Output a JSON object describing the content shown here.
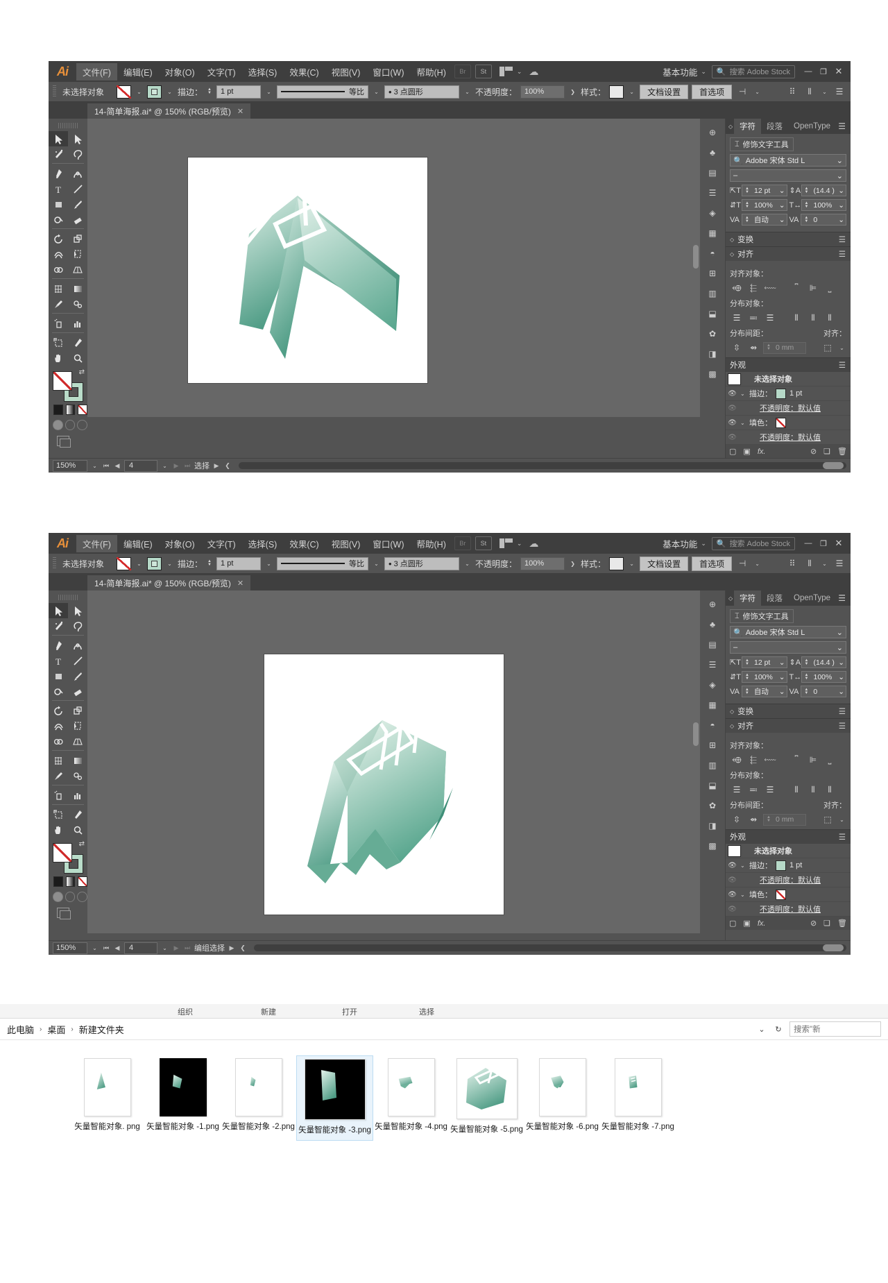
{
  "app": {
    "logo": "Ai",
    "menu": [
      "文件(F)",
      "编辑(E)",
      "对象(O)",
      "文字(T)",
      "选择(S)",
      "效果(C)",
      "视图(V)",
      "窗口(W)",
      "帮助(H)"
    ],
    "bridge_icon": "Br",
    "stock_icon": "St",
    "workspace": "基本功能",
    "search_placeholder": "搜索 Adobe Stock",
    "win_min": "—",
    "win_max": "❐",
    "win_close": "✕"
  },
  "control_bar": {
    "selection_label": "未选择对象",
    "fill_swatch": "none-swatch",
    "stroke_swatch": "mint-swatch",
    "stroke_label": "描边：",
    "stroke_weight": "1 pt",
    "stroke_profile": "等比",
    "brush": "3 点圆形",
    "opacity_label": "不透明度：",
    "opacity_value": "100%",
    "style_label": "样式：",
    "doc_setup": "文档设置",
    "preferences": "首选项",
    "align_icon": "align-icon"
  },
  "document": {
    "tab_title": "14-简单海报.ai* @ 150% (RGB/预览)",
    "tab_close": "✕"
  },
  "toolbar": {
    "tools": [
      "selection-tool",
      "direct-selection-tool",
      "magic-wand-tool",
      "lasso-tool",
      "pen-tool",
      "curvature-tool",
      "type-tool",
      "line-segment-tool",
      "rectangle-tool",
      "paintbrush-tool",
      "shaper-tool",
      "eraser-tool",
      "rotate-tool",
      "scale-tool",
      "width-tool",
      "free-transform-tool",
      "shape-builder-tool",
      "perspective-grid-tool",
      "mesh-tool",
      "gradient-tool",
      "eyedropper-tool",
      "blend-tool",
      "symbol-sprayer-tool",
      "column-graph-tool",
      "artboard-tool",
      "slice-tool",
      "hand-tool",
      "zoom-tool"
    ],
    "fill_color": "#ffffff",
    "stroke_color": "#b9dcc9"
  },
  "panels": {
    "character": {
      "tabs": [
        "字符",
        "段落",
        "OpenType"
      ],
      "active_tab": "字符",
      "touch_type_tool": "修饰文字工具",
      "font_family": "Adobe 宋体 Std L",
      "font_style": "–",
      "font_size": "12 pt",
      "leading": "(14.4 )",
      "horizontal_scale": "100%",
      "vertical_scale": "100%",
      "kerning": "自动",
      "tracking": "0"
    },
    "transform": {
      "title": "变换"
    },
    "align": {
      "title": "对齐",
      "align_objects_label": "对齐对象：",
      "distribute_objects_label": "分布对象：",
      "distribute_spacing_label": "分布间距：",
      "align_to_label": "对齐：",
      "spacing_value": "0 mm"
    },
    "appearance": {
      "title": "外观",
      "no_selection": "未选择对象",
      "stroke_label": "描边：",
      "stroke_weight": "1 pt",
      "stroke_opacity": "不透明度：默认值",
      "fill_label": "填色：",
      "fill_opacity": "不透明度：默认值",
      "footer_icons": [
        "new-stroke-icon",
        "new-fill-icon",
        "fx-icon",
        "clear-appearance-icon",
        "duplicate-item-icon",
        "delete-item-icon"
      ]
    }
  },
  "status_bar_top": {
    "zoom": "150%",
    "page": "4",
    "status": "选择"
  },
  "status_bar_bottom": {
    "zoom": "150%",
    "page": "4",
    "status": "编组选择"
  },
  "explorer": {
    "ribbon_tail": [
      "组织",
      "新建",
      "打开",
      "选择"
    ],
    "breadcrumb": [
      "此电脑",
      "桌面",
      "新建文件夹"
    ],
    "breadcrumb_sep": "›",
    "refresh_icon": "refresh-icon",
    "dropdown_icon": "chevron-down-icon",
    "search_placeholder": "搜索\"新",
    "files": [
      {
        "name": "矢量智能对象.\npng",
        "bg": "white",
        "size": "small",
        "shape": "shape-a"
      },
      {
        "name": "矢量智能对象\n-1.png",
        "bg": "black",
        "size": "small",
        "shape": "shape-b"
      },
      {
        "name": "矢量智能对象\n-2.png",
        "bg": "white",
        "size": "small",
        "shape": "shape-c"
      },
      {
        "name": "矢量智能对象\n-3.png",
        "bg": "black",
        "size": "big",
        "shape": "shape-d",
        "selected": true
      },
      {
        "name": "矢量智能对象\n-4.png",
        "bg": "white",
        "size": "small",
        "shape": "shape-e"
      },
      {
        "name": "矢量智能对象\n-5.png",
        "bg": "white",
        "size": "big",
        "shape": "shape-f"
      },
      {
        "name": "矢量智能对象\n-6.png",
        "bg": "white",
        "size": "small",
        "shape": "shape-g"
      },
      {
        "name": "矢量智能对象\n-7.png",
        "bg": "white",
        "size": "small",
        "shape": "shape-h"
      }
    ]
  },
  "colors": {
    "ui_panel": "#535353",
    "ui_dark": "#3f3f3f",
    "canvas": "#676767",
    "artwork_light": "#dff0e8",
    "artwork_mid": "#8fc9b4",
    "artwork_dark": "#4e9c85",
    "selection_blue": "#bcdcf2"
  }
}
